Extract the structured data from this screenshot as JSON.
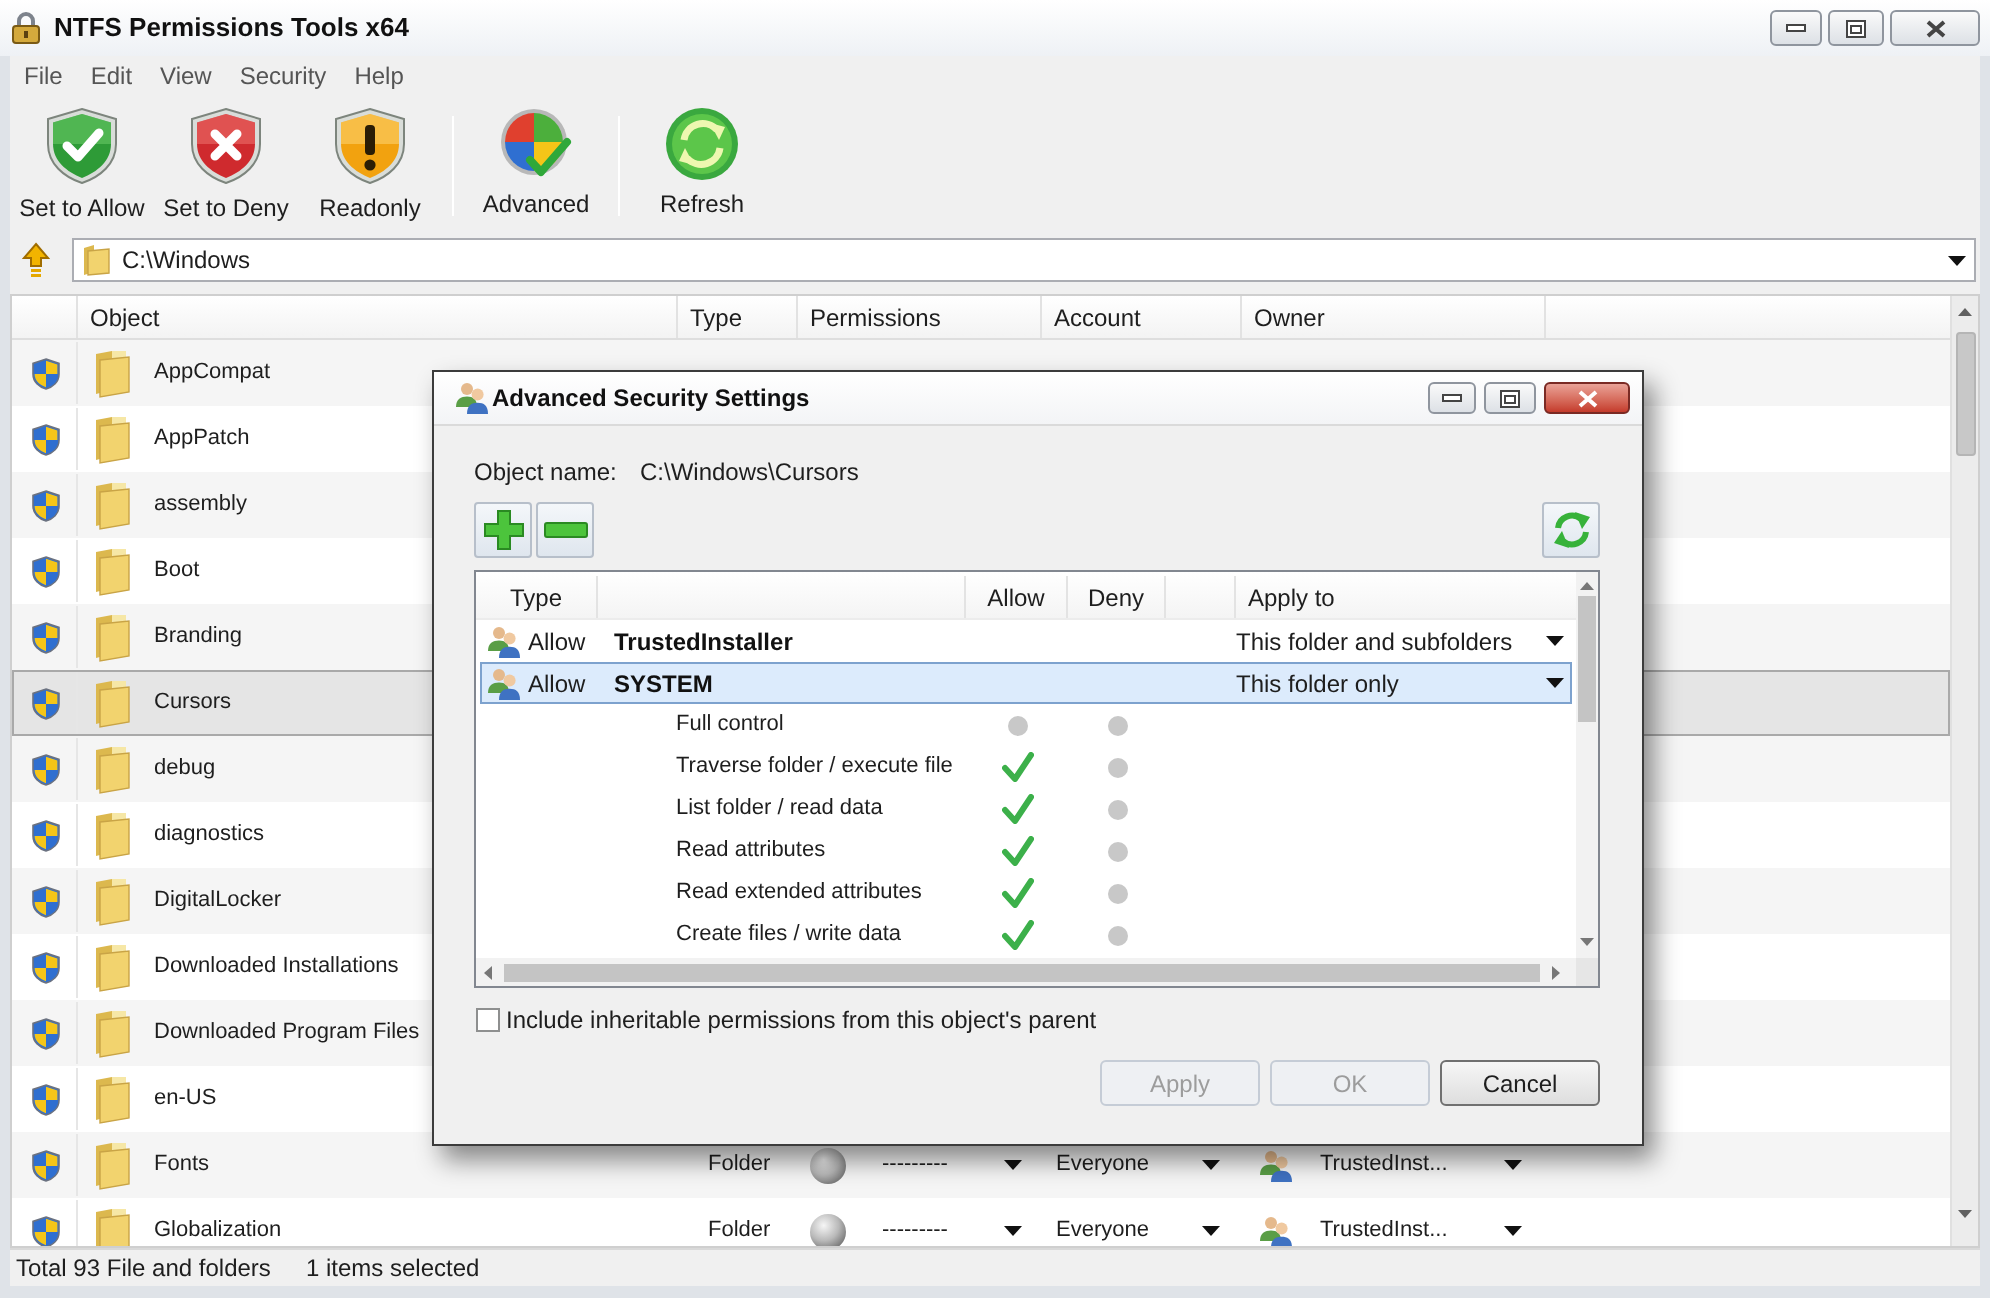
{
  "window": {
    "title": "NTFS Permissions Tools x64"
  },
  "menu": [
    "File",
    "Edit",
    "View",
    "Security",
    "Help"
  ],
  "toolbar": [
    {
      "buttons": [
        {
          "label": "Set to Allow",
          "kind": "allow"
        },
        {
          "label": "Set to Deny",
          "kind": "deny"
        },
        {
          "label": "Readonly",
          "kind": "readonly"
        }
      ]
    },
    {
      "buttons": [
        {
          "label": "Advanced",
          "kind": "advanced"
        }
      ]
    },
    {
      "buttons": [
        {
          "label": "Refresh",
          "kind": "refresh"
        }
      ]
    }
  ],
  "address_bar": {
    "path": "C:\\Windows"
  },
  "table": {
    "columns": [
      "Object",
      "Type",
      "Permissions",
      "Account",
      "Owner"
    ],
    "rows": [
      {
        "object": "AppCompat",
        "selected": false
      },
      {
        "object": "AppPatch",
        "selected": false
      },
      {
        "object": "assembly",
        "selected": false
      },
      {
        "object": "Boot",
        "selected": false
      },
      {
        "object": "Branding",
        "selected": false
      },
      {
        "object": "Cursors",
        "selected": true
      },
      {
        "object": "debug",
        "selected": false
      },
      {
        "object": "diagnostics",
        "selected": false
      },
      {
        "object": "DigitalLocker",
        "selected": false
      },
      {
        "object": "Downloaded Installations",
        "selected": false
      },
      {
        "object": "Downloaded Program Files",
        "selected": false
      },
      {
        "object": "en-US",
        "selected": false
      },
      {
        "object": "Fonts",
        "type": "Folder",
        "permissions": "---------",
        "account": "Everyone",
        "owner": "TrustedInst...",
        "selected": false
      },
      {
        "object": "Globalization",
        "type": "Folder",
        "permissions": "---------",
        "account": "Everyone",
        "owner": "TrustedInst...",
        "selected": false
      }
    ]
  },
  "status_bar": {
    "total": "Total 93 File and folders",
    "selection": "1 items selected"
  },
  "dialog": {
    "title": "Advanced Security Settings",
    "object_name_label": "Object name:",
    "object_name": "C:\\Windows\\Cursors",
    "columns": [
      "Type",
      "Allow",
      "Deny",
      "Apply to"
    ],
    "entries": [
      {
        "type": "Allow",
        "account": "TrustedInstaller",
        "apply_to": "This folder and subfolders",
        "selected": false
      },
      {
        "type": "Allow",
        "account": "SYSTEM",
        "apply_to": "This folder only",
        "selected": true,
        "permissions": [
          {
            "name": "Full control",
            "allow": false,
            "deny": false
          },
          {
            "name": "Traverse folder / execute file",
            "allow": true,
            "deny": false
          },
          {
            "name": "List folder / read data",
            "allow": true,
            "deny": false
          },
          {
            "name": "Read attributes",
            "allow": true,
            "deny": false
          },
          {
            "name": "Read extended attributes",
            "allow": true,
            "deny": false
          },
          {
            "name": "Create files / write data",
            "allow": true,
            "deny": false
          }
        ]
      }
    ],
    "inherit": {
      "label": "Include inheritable permissions from this object's parent",
      "checked": false
    },
    "buttons": [
      {
        "label": "Apply",
        "disabled": true
      },
      {
        "label": "OK",
        "disabled": true
      },
      {
        "label": "Cancel",
        "disabled": false
      }
    ]
  }
}
